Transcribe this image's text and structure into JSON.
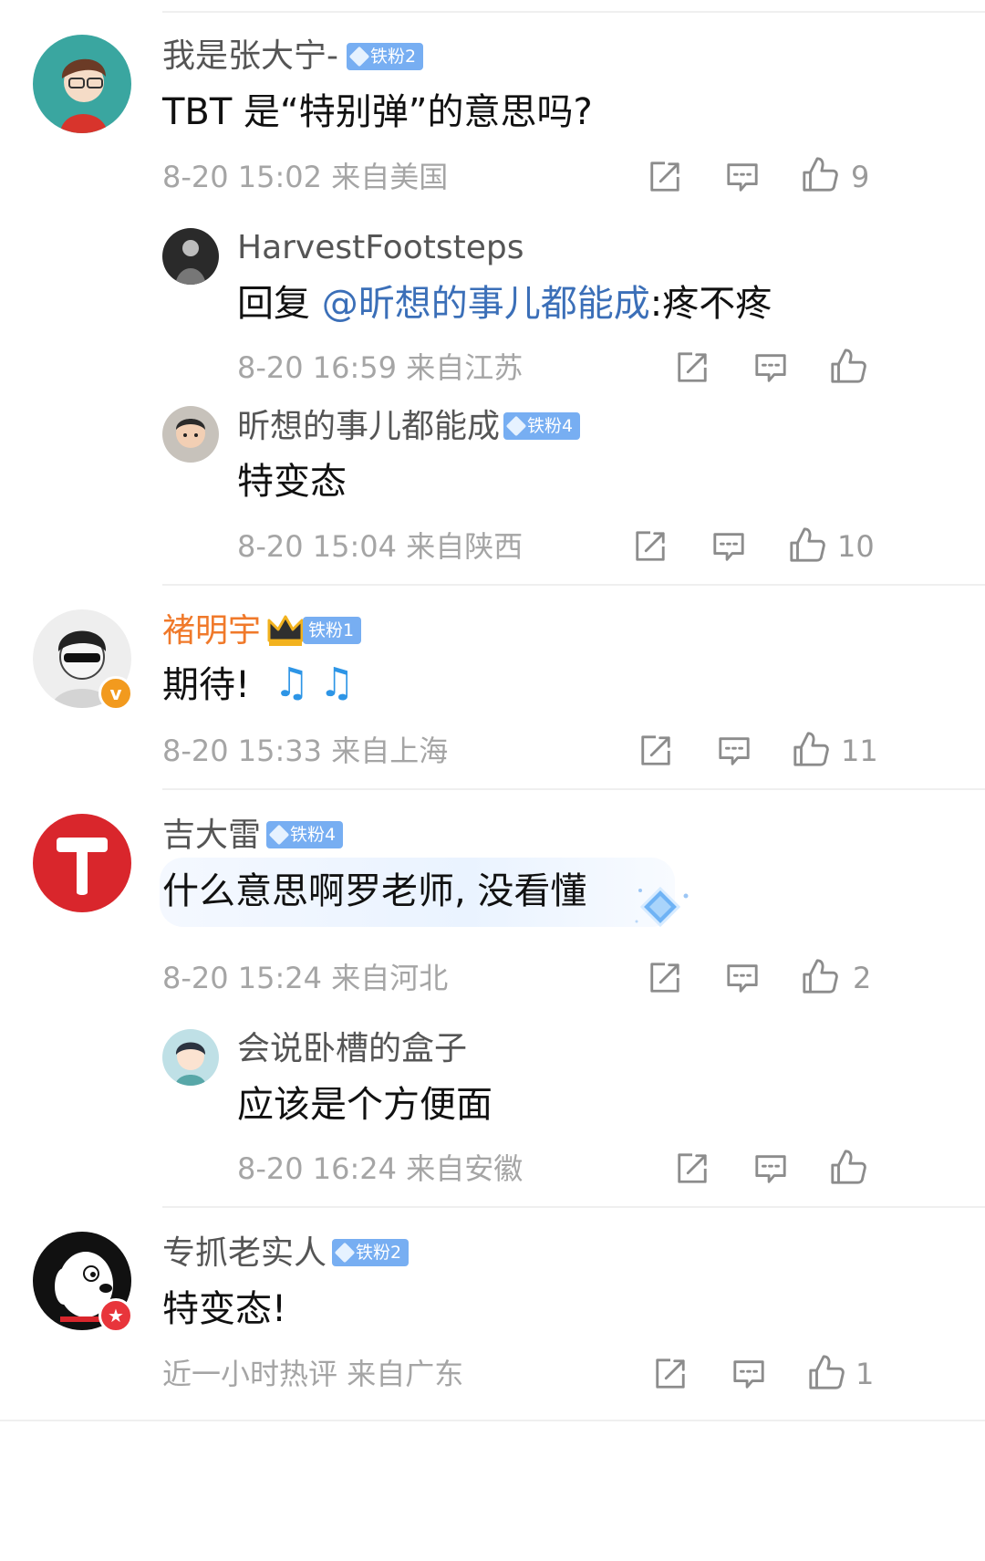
{
  "colors": {
    "accent_blue": "#3b6fb8",
    "vip_orange": "#f0792a",
    "badge_blue": "#77aef2",
    "meta_gray": "#a5a5a5"
  },
  "icons": {
    "share": "share-icon",
    "comment": "comment-icon",
    "like": "like-icon"
  },
  "comments": [
    {
      "name": "我是张大宁-",
      "badge": "铁粉2",
      "text": "TBT 是“特别弹”的意思吗?",
      "time": "8-20 15:02",
      "location": "来自美国",
      "likes": "9"
    },
    {
      "name": "HarvestFootsteps",
      "reply_prefix": "回复 ",
      "reply_mention": "@昕想的事儿都能成",
      "reply_text": ":疼不疼",
      "time": "8-20 16:59",
      "location": "来自江苏"
    },
    {
      "name": "昕想的事儿都能成",
      "badge": "铁粉4",
      "text": "特变态",
      "time": "8-20 15:04",
      "location": "来自陕西",
      "likes": "10"
    },
    {
      "name": "褚明宇",
      "badge": "铁粉1",
      "text": "期待!",
      "music_notes": "♫♫",
      "time": "8-20 15:33",
      "location": "来自上海",
      "likes": "11"
    },
    {
      "name": "吉大雷",
      "badge": "铁粉4",
      "text": "什么意思啊罗老师, 没看懂",
      "time": "8-20 15:24",
      "location": "来自河北",
      "likes": "2"
    },
    {
      "name": "会说卧槽的盒子",
      "text": "应该是个方便面",
      "time": "8-20 16:24",
      "location": "来自安徽"
    },
    {
      "name": "专抓老实人",
      "badge": "铁粉2",
      "text": "特变态!",
      "time": "近一小时热评",
      "location": "来自广东",
      "likes": "1"
    }
  ]
}
